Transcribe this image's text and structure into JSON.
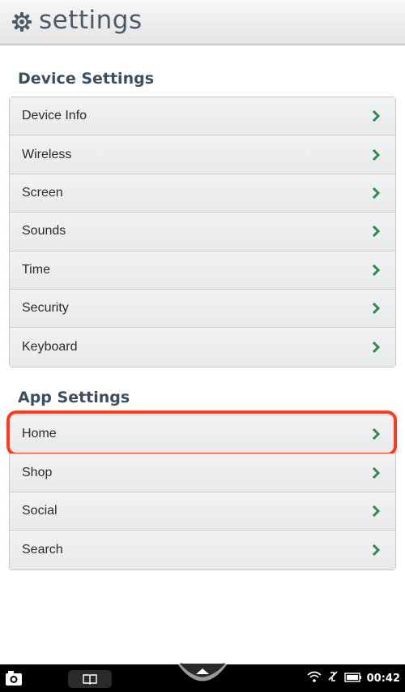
{
  "header": {
    "title": "settings",
    "icon": "gear-icon"
  },
  "device_settings": {
    "title": "Device Settings",
    "items": [
      {
        "label": "Device Info"
      },
      {
        "label": "Wireless"
      },
      {
        "label": "Screen"
      },
      {
        "label": "Sounds"
      },
      {
        "label": "Time"
      },
      {
        "label": "Security"
      },
      {
        "label": "Keyboard"
      }
    ]
  },
  "app_settings": {
    "title": "App Settings",
    "items": [
      {
        "label": "Home",
        "highlighted": true
      },
      {
        "label": "Shop"
      },
      {
        "label": "Social"
      },
      {
        "label": "Search"
      }
    ]
  },
  "status_bar": {
    "time": "00:42",
    "icons": [
      "camera-icon",
      "book-icon",
      "nook-menu-icon",
      "wifi-icon",
      "sync-off-icon",
      "battery-icon"
    ]
  },
  "colors": {
    "chevron": "#2e8a4e",
    "highlight": "#ff3a1f",
    "heading": "#3d4f5e"
  }
}
